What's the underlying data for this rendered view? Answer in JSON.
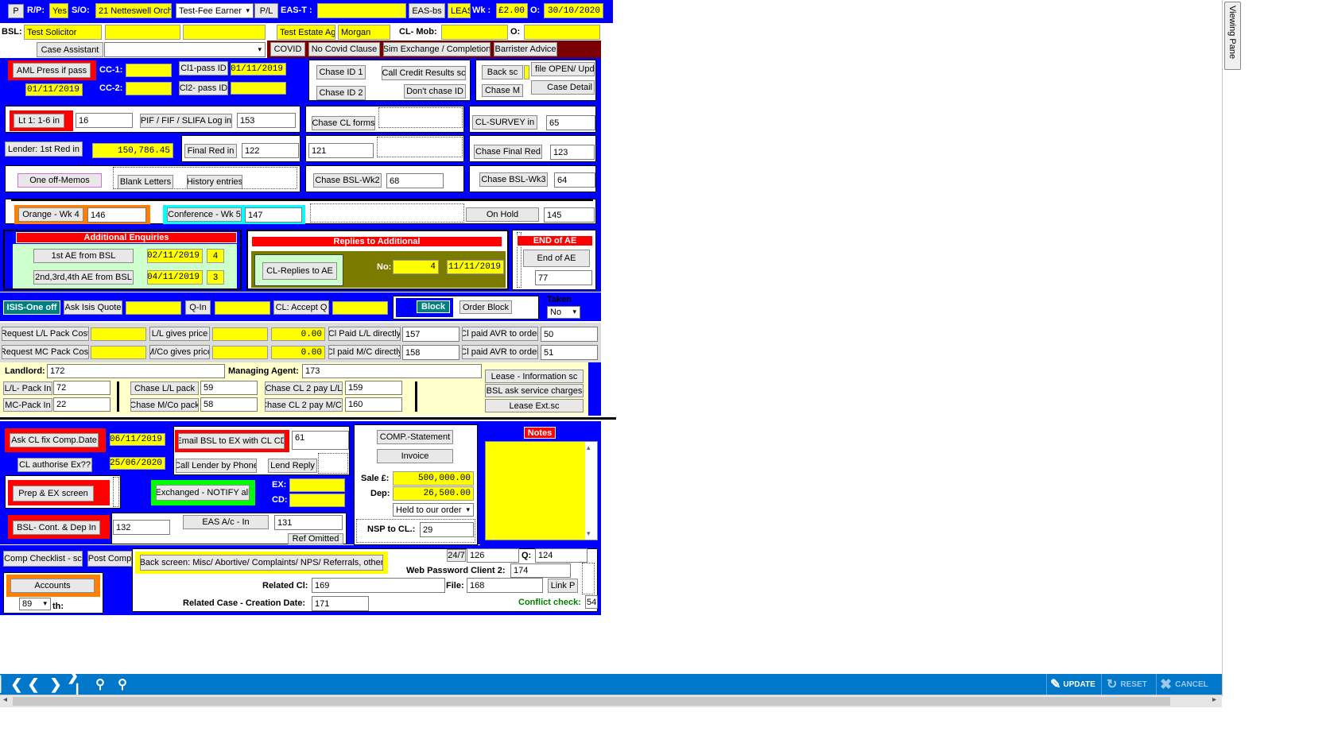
{
  "top": {
    "p": "P",
    "rp_label": "R/P:",
    "rp_value": "Yes",
    "so_label": "S/O:",
    "so_value": "21 Netteswell Orchar",
    "fee_earner": "Test-Fee Earner",
    "pl": "P/L",
    "eas_t": "EAS-T :",
    "eas_bs": "EAS-bs",
    "leas": "LEAS",
    "wk_label": "Wk :",
    "wk_value": "£2.00",
    "o_label": "O:",
    "o_value": "30/10/2020"
  },
  "row2": {
    "bsl": "BSL:",
    "solicitor": "Test Solicitor",
    "estate_agent": "Test Estate Age",
    "morgan": "Morgan",
    "cl_mob": "CL- Mob:",
    "o2": "O:"
  },
  "row3": {
    "case_assistant": "Case Assistant",
    "covid": "COVID",
    "no_covid": "No Covid Clause",
    "sim_exchange": "Sim Exchange / Completion",
    "barrister": "Barrister Advice"
  },
  "aml": {
    "aml_btn": "AML Press if pass",
    "aml_date": "01/11/2019",
    "cc1": "CC-1:",
    "cc2": "CC-2:",
    "cl1_pass": "Cl1-pass ID",
    "cl1_date": "01/11/2019",
    "cl2_pass": "Cl2- pass ID",
    "chase_id1": "Chase ID 1",
    "chase_id2": "Chase ID 2",
    "call_credit": "Call Credit Results sc",
    "dont_chase": "Don't chase ID",
    "back_sc": "Back sc",
    "chase_m": "Chase M",
    "file_open": "file OPEN/ Upda",
    "case_detail": "Case Detail"
  },
  "lt": {
    "lt1": "Lt 1: 1-6 in",
    "lt1_val": "16",
    "pif": "PIF / FIF / SLIFA Log in",
    "pif_val": "153",
    "chase_cl_forms": "Chase CL forms",
    "cl_survey": "CL-SURVEY in",
    "cl_survey_val": "65",
    "lender_red": "Lender: 1st Red in",
    "lender_amount": "150,786.45",
    "final_red": "Final Red in",
    "final_red_val": "122",
    "val121": "121",
    "chase_final_red": "Chase Final Red",
    "chase_final_val": "123",
    "one_off_memos": "One off-Memos",
    "blank_letters": "Blank Letters",
    "history": "History entries",
    "chase_bsl_wk2": "Chase BSL-Wk2",
    "wk2_val": "68",
    "chase_bsl_wk3": "Chase BSL-Wk3",
    "wk3_val": "64",
    "orange": "Orange - Wk 4",
    "orange_val": "146",
    "conference": "Conference - Wk 5",
    "conference_val": "147",
    "on_hold": "On Hold",
    "on_hold_val": "145"
  },
  "ae": {
    "header": "Additional Enquiries",
    "first_ae": "1st  AE from  BSL",
    "first_date": "02/11/2019",
    "first_n": "4",
    "second_ae": "2nd,3rd,4th AE from BSL",
    "second_date": "04/11/2019",
    "second_n": "3",
    "replies_header": "Replies to Additional",
    "cl_replies": "CL-Replies to  AE",
    "no_label": "No:",
    "no_val": "4",
    "replies_date": "11/11/2019",
    "end_header": "END of AE",
    "end_btn": "End of AE",
    "end_val": "77"
  },
  "isis": {
    "isis_one_off": "ISIS-One off",
    "ask_isis": "Ask Isis Quote",
    "q_in": "Q-In",
    "cl_accept": "CL: Accept Q",
    "block": "Block",
    "order_block": "Order Block",
    "taken": "Taken",
    "taken_val": "No"
  },
  "pack": {
    "req_ll": "Request L/L Pack Cost",
    "ll_gives": "L/L gives price",
    "ll_amt": "0.00",
    "req_mc": "Request MC Pack Cost",
    "mco_gives": "M/Co gives price",
    "mc_amt": "0.00",
    "cl_paid_ll": "Cl Paid L/L directly",
    "cl_paid_ll_val": "157",
    "cl_paid_mc": "Cl paid M/C directly",
    "cl_paid_mc_val": "158",
    "avr1": "Cl paid AVR to order",
    "avr1_val": "50",
    "avr2": "Cl paid AVR to order",
    "avr2_val": "51"
  },
  "landlord": {
    "landlord_lbl": "Landlord:",
    "landlord_val": "172",
    "managing_lbl": "Managing Agent:",
    "managing_val": "173",
    "ll_pack_in": "L/L- Pack In",
    "ll_pack_val": "72",
    "mc_pack_in": "MC-Pack In",
    "mc_pack_val": "22",
    "chase_ll_pack": "Chase L/L pack",
    "chase_ll_val": "59",
    "chase_mco_pack": "Chase M/Co pack",
    "chase_mco_val": "58",
    "chase_cl2_ll": "Chase CL 2 pay L/L",
    "chase_cl2_ll_val": "159",
    "chase_cl2_mco": "Chase CL 2 pay M/Co",
    "chase_cl2_mco_val": "160",
    "lease_info": "Lease - Information  sc",
    "bsl_service": "BSL ask service charges",
    "lease_ext": "Lease Ext.sc"
  },
  "comp": {
    "ask_cl_fix": "Ask CL fix Comp.Date",
    "ask_date": "06/11/2019",
    "cl_authorise": "CL authorise Ex??",
    "auth_date": "25/06/2020",
    "email_bsl": "Email BSL to EX with CL CD",
    "email_val": "61",
    "call_lender": "Call Lender by Phone",
    "lend_reply": "Lend Reply",
    "prep_ex": "Prep & EX screen",
    "exchanged": "Exchanged - NOTIFY all",
    "ex_lbl": "EX:",
    "cd_lbl": "CD:",
    "bsl_cont": "BSL- Cont. & Dep In",
    "bsl_cont_val": "132",
    "eas_ac": "EAS A/c - In",
    "eas_ac_val": "131",
    "ref_omitted": "Ref Omitted",
    "comp_statement": "COMP.-Statement",
    "invoice": "Invoice",
    "sale_lbl": "Sale £:",
    "sale_val": "500,000.00",
    "dep_lbl": "Dep:",
    "dep_val": "26,500.00",
    "held": "Held to our order",
    "nsp_lbl": "NSP to CL.:",
    "nsp_val": "29",
    "notes": "Notes"
  },
  "bottom": {
    "comp_checklist": "Comp Checklist - sc",
    "post_comp": "Post Comp",
    "back_screen": "Back screen: Misc/ Abortive/ Complaints/ NPS/ Referrals, other",
    "accounts": "Accounts",
    "acc_num": "89",
    "th": "th:",
    "h24": "24/7",
    "h24_val": "126",
    "q_lbl": "Q:",
    "q_val": "124",
    "web_pw": "Web Password Client 2:",
    "web_pw_val": "174",
    "related_cl": "Related Cl:",
    "related_cl_val": "169",
    "file_lbl": "File:",
    "file_val": "168",
    "link_p": "Link P",
    "related_case": "Related Case - Creation Date:",
    "related_case_val": "171",
    "conflict": "Conflict check:",
    "conflict_val": "54"
  },
  "viewing_pane": "Viewing Pane",
  "toolbar": {
    "update": "UPDATE",
    "reset": "RESET",
    "cancel": "CANCEL"
  }
}
